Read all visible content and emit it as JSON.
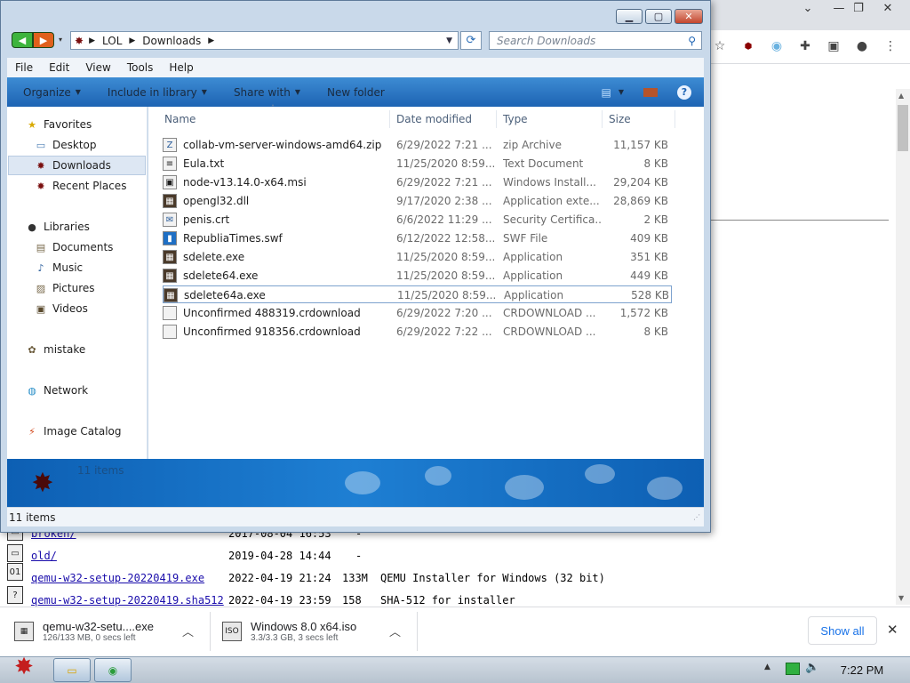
{
  "explorer": {
    "breadcrumb": [
      "LOL",
      "Downloads"
    ],
    "search_placeholder": "Search Downloads",
    "menu": [
      "File",
      "Edit",
      "View",
      "Tools",
      "Help"
    ],
    "commands": [
      "Organize",
      "Include in library",
      "Share with",
      "New folder"
    ],
    "nav": {
      "favorites": "Favorites",
      "desktop": "Desktop",
      "downloads": "Downloads",
      "recent": "Recent Places",
      "libraries": "Libraries",
      "documents": "Documents",
      "music": "Music",
      "pictures": "Pictures",
      "videos": "Videos",
      "mistake": "mistake",
      "network": "Network",
      "image_catalog": "Image Catalog"
    },
    "columns": {
      "name": "Name",
      "date": "Date modified",
      "type": "Type",
      "size": "Size"
    },
    "files": [
      {
        "name": "collab-vm-server-windows-amd64.zip",
        "date": "6/29/2022 7:21 ...",
        "type": "zip Archive",
        "size": "11,157 KB"
      },
      {
        "name": "Eula.txt",
        "date": "11/25/2020 8:59...",
        "type": "Text Document",
        "size": "8 KB"
      },
      {
        "name": "node-v13.14.0-x64.msi",
        "date": "6/29/2022 7:21 ...",
        "type": "Windows Install...",
        "size": "29,204 KB"
      },
      {
        "name": "opengl32.dll",
        "date": "9/17/2020 2:38 ...",
        "type": "Application exte...",
        "size": "28,869 KB"
      },
      {
        "name": "penis.crt",
        "date": "6/6/2022 11:29 ...",
        "type": "Security Certifica...",
        "size": "2 KB"
      },
      {
        "name": "RepubliaTimes.swf",
        "date": "6/12/2022 12:58...",
        "type": "SWF File",
        "size": "409 KB"
      },
      {
        "name": "sdelete.exe",
        "date": "11/25/2020 8:59...",
        "type": "Application",
        "size": "351 KB"
      },
      {
        "name": "sdelete64.exe",
        "date": "11/25/2020 8:59...",
        "type": "Application",
        "size": "449 KB"
      },
      {
        "name": "sdelete64a.exe",
        "date": "11/25/2020 8:59...",
        "type": "Application",
        "size": "528 KB"
      },
      {
        "name": "Unconfirmed 488319.crdownload",
        "date": "6/29/2022 7:20 ...",
        "type": "CRDOWNLOAD ...",
        "size": "1,572 KB"
      },
      {
        "name": "Unconfirmed 918356.crdownload",
        "date": "6/29/2022 7:22 ...",
        "type": "CRDOWNLOAD ...",
        "size": "8 KB"
      }
    ],
    "details_count": "11 items",
    "status": "11 items"
  },
  "listing": [
    {
      "name": "broken/",
      "date": "2017-08-04 16:53",
      "size": "-",
      "desc": ""
    },
    {
      "name": "old/",
      "date": "2019-04-28 14:44",
      "size": "-",
      "desc": ""
    },
    {
      "name": "qemu-w32-setup-20220419.exe",
      "date": "2022-04-19 21:24",
      "size": "133M",
      "desc": "QEMU Installer for Windows (32 bit)"
    },
    {
      "name": "qemu-w32-setup-20220419.sha512",
      "date": "2022-04-19 23:59",
      "size": "158",
      "desc": "SHA-512 for installer"
    }
  ],
  "downloads": [
    {
      "name": "qemu-w32-setu....exe",
      "status": "126/133 MB, 0 secs left"
    },
    {
      "name": "Windows 8.0 x64.iso",
      "status": "3.3/3.3 GB, 3 secs left"
    }
  ],
  "show_all": "Show all",
  "clock": "7:22 PM",
  "colors": {
    "accent": "#1d63b3",
    "chrome_link": "#1a73e8"
  }
}
